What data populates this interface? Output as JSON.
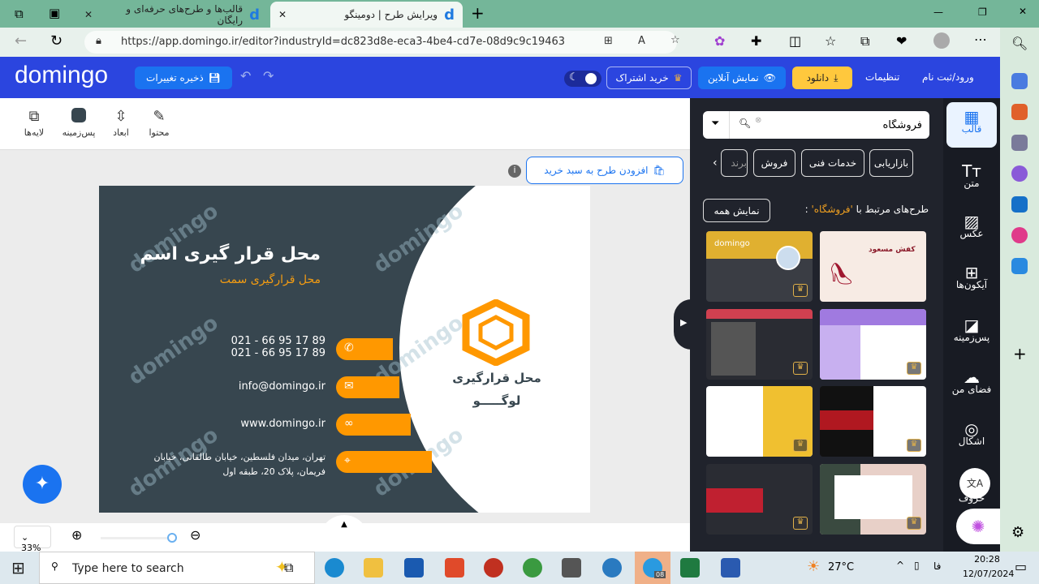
{
  "browser": {
    "tabs": [
      {
        "title": "قالب‌ها و طرح‌های حرفه‌ای و رایگان",
        "active": false
      },
      {
        "title": "ویرایش طرح | دومینگو",
        "active": true
      }
    ],
    "url": "https://app.domingo.ir/editor?industryId=dc823d8e-eca3-4be4-cd7e-08d9c9c19463"
  },
  "header": {
    "logo": "domingo",
    "save": "ذخیره تغییرات",
    "subscribe": "خرید اشتراک",
    "preview": "نمایش آنلاین",
    "download": "دانلود",
    "settings": "تنظیمات",
    "login": "ورود/ثبت نام",
    "colors": {
      "bar": "#2b45df",
      "download": "#ffc83d",
      "preview": "#1a73f0"
    }
  },
  "toolbar": {
    "content": "محتوا",
    "dimensions": "ابعاد",
    "background": "پس‌زمینه",
    "layers": "لایه‌ها"
  },
  "stage": {
    "add_to_cart": "افزودن طرح به سبد خرید"
  },
  "card": {
    "name": "محل قرار گیری اسم",
    "title": "محل قرارگیری سمت",
    "phone1": "021 - 66 95 17 89",
    "phone2": "021 - 66 95 17 89",
    "email": "info@domingo.ir",
    "website": "www.domingo.ir",
    "address1": "تهران، میدان فلسطین، خیابان طالقانی، خیابان",
    "address2": "فریمان، پلاک 20، طبقه اول",
    "logo1": "محل قرارگیری",
    "logo2": "لوگـــــو",
    "watermark": "domingo",
    "colors": {
      "bg": "#37464f",
      "accent": "#ff9800"
    }
  },
  "zoom": {
    "level": "33%",
    "value": 0.33
  },
  "panel": {
    "search_value": "فروشگاه",
    "chips": [
      "بازاریابی",
      "خدمات فنی",
      "فروش",
      "برند"
    ],
    "related_label": "طرح‌های مرتبط با",
    "related_term": "'فروشگاه'",
    "show_all": "نمایش همه",
    "thumbs": [
      {
        "title": "کفش مسعود"
      },
      {
        "title": "domingo"
      },
      {
        "title": ""
      },
      {
        "title": ""
      },
      {
        "title": ""
      },
      {
        "title": ""
      },
      {
        "title": ""
      },
      {
        "title": ""
      }
    ]
  },
  "sidebar": {
    "items": [
      "قالب",
      "متن",
      "عکس",
      "آیکون‌ها",
      "پس‌زمینه",
      "فضای من",
      "اشکال",
      "حروف"
    ]
  },
  "taskbar": {
    "search": "Type here to search",
    "weather": "27°C",
    "lang": "فا",
    "time": "20:28",
    "date": "12/07/2024",
    "telegram_badge": "08"
  }
}
